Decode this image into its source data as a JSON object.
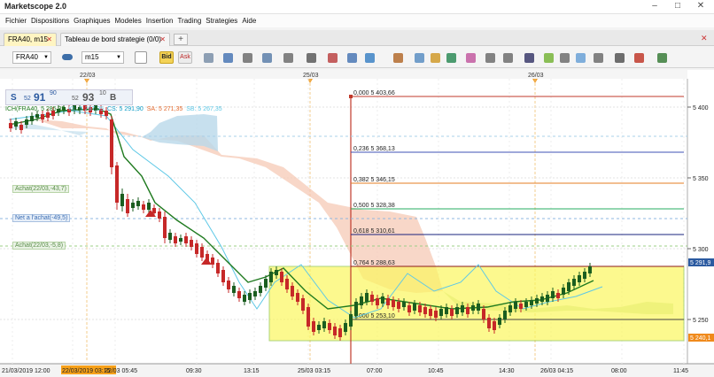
{
  "app": {
    "title": "Marketscope 2.0",
    "min": "–",
    "max": "□",
    "close": "✕"
  },
  "menu": [
    "Fichier",
    "Dispositions",
    "Graphiques",
    "Modeles",
    "Insertion",
    "Trading",
    "Strategies",
    "Aide"
  ],
  "tabs": [
    {
      "label": "FRA40, m15",
      "active": true,
      "close": "✕"
    },
    {
      "label": "Tableau de bord strategie (0/0)",
      "active": false,
      "close": "✕"
    }
  ],
  "tab_add": "+",
  "toolbar": {
    "symbol": "FRA40",
    "timeframe": "m15",
    "bid": "Bid",
    "ask": "Ask",
    "icons": [
      "candle-type-icon",
      "cursor-icon",
      "crosshair-icon",
      "zoom-in-icon",
      "zoom-out-icon",
      "text-icon",
      "arrow-icon",
      "order-icon",
      "indicator-icon",
      "hide-icon",
      "refresh-icon",
      "pencil-icon",
      "picture-icon",
      "color-icon",
      "pitchfork-icon",
      "channel-icon",
      "lines-icon",
      "arrow-up-icon",
      "pen-line-icon",
      "ellipse-icon",
      "shape-icon",
      "fibo-icon",
      "eraser-icon",
      "tree-icon"
    ]
  },
  "price_widget": {
    "sell_label": "S",
    "sell_pre": "52",
    "sell_big": "91",
    "sell_sup": "90",
    "buy_pre": "52",
    "buy_big": "93",
    "buy_sup": "10",
    "buy_label": "B"
  },
  "indicator_legend": {
    "name": "ICH(FRA40,",
    "tenkan": "5 285,35",
    "kijun": "KL: 5 267,35",
    "chikou": "CS: 5 291,90",
    "senkou_a": "SA: 5 271,35",
    "senkou_b": "SB: 5 267,35"
  },
  "position_labels": [
    {
      "text": "Achat(22/03,-43,7)"
    },
    {
      "text": "Net a l'achat(-49,5)"
    },
    {
      "text": "Achat(22/03,-5,8)"
    }
  ],
  "date_header": [
    "22/03",
    "25/03",
    "26/03"
  ],
  "fibo_levels": [
    {
      "label": "0,000 5 403,66",
      "color": "#c0392b"
    },
    {
      "label": "0,236 5 368,13",
      "color": "#3f51b5"
    },
    {
      "label": "0,382 5 346,15",
      "color": "#e67e22"
    },
    {
      "label": "0,500 5 328,38",
      "color": "#27ae60"
    },
    {
      "label": "0,618 5 310,61",
      "color": "#1a237e"
    },
    {
      "label": "0,764 5 288,63",
      "color": "#8b1a1a"
    },
    {
      "label": "1,000 5 253,10",
      "color": "#444444"
    }
  ],
  "price_axis": {
    "ticks": [
      "5 400",
      "5 350",
      "5 300",
      "5 250"
    ],
    "current_price": "5 291,9",
    "low_marker": "5 240,1"
  },
  "time_axis": {
    "labels": [
      "21/03/2019 12:00",
      "22/03/2019 03:15",
      "22/03 05:45",
      "09:30",
      "13:15",
      "25/03 03:15",
      "07:00",
      "10:45",
      "14:30",
      "26/03 04:15",
      "08:00",
      "11:45"
    ],
    "highlighted": "22/03/2019 03:15"
  },
  "colors": {
    "cloud_bull": "#f6c9b5",
    "cloud_bear": "#b9d8ea",
    "tenkan": "#1f7a1f",
    "kijun": "#5ec8e6",
    "up_candle": "#1b5e20",
    "down_candle": "#c62828",
    "zone_fill": "#fbf75f"
  }
}
